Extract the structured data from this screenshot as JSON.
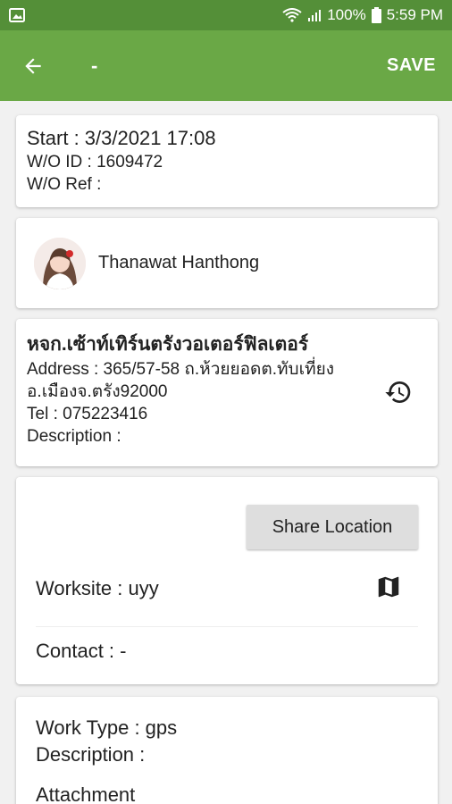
{
  "status_bar": {
    "battery": "100%",
    "time": "5:59 PM"
  },
  "app_bar": {
    "title": "-",
    "save_label": "SAVE"
  },
  "work_order": {
    "start_label": "Start : 3/3/2021  17:08",
    "wo_id_label": "W/O ID : 1609472",
    "wo_ref_label": "W/O Ref :"
  },
  "assignee": {
    "name": "Thanawat Hanthong"
  },
  "customer": {
    "company": "หจก.เซ้าท์เทิร์นตรังวอเตอร์ฟิลเตอร์",
    "address": "Address : 365/57-58 ถ.ห้วยยอดต.ทับเที่ยงอ.เมืองจ.ตรัง92000",
    "tel": "Tel : 075223416",
    "description": "Description :"
  },
  "location": {
    "share_label": "Share Location",
    "worksite": "Worksite : uyy",
    "contact": "Contact : -"
  },
  "work": {
    "type": "Work Type : gps",
    "description": "Description :",
    "attachment": "Attachment"
  }
}
